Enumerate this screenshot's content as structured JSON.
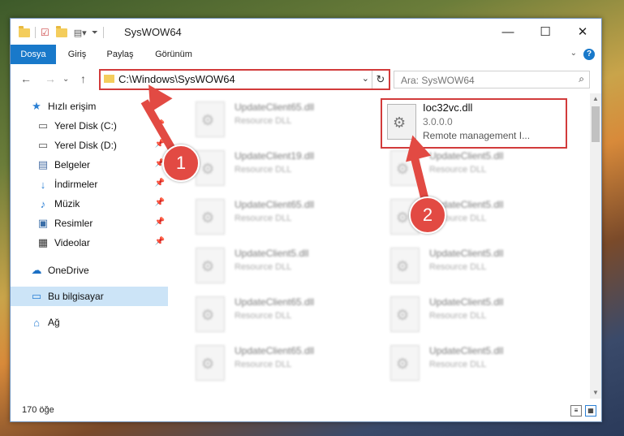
{
  "window": {
    "title": "SysWOW64",
    "controls": {
      "minimize": "—",
      "maximize": "☐",
      "close": "✕"
    }
  },
  "ribbon": {
    "tabs": [
      {
        "label": "Dosya",
        "active": true
      },
      {
        "label": "Giriş"
      },
      {
        "label": "Paylaş"
      },
      {
        "label": "Görünüm"
      }
    ],
    "help": "?"
  },
  "address": {
    "path": "C:\\Windows\\SysWOW64",
    "search_placeholder": "Ara: SysWOW64"
  },
  "nav_pane": {
    "items": [
      {
        "label": "Hızlı erişim",
        "icon": "star-icon",
        "pinned": false
      },
      {
        "label": "Yerel Disk (C:)",
        "icon": "drive-icon",
        "pinned": true
      },
      {
        "label": "Yerel Disk (D:)",
        "icon": "drive-icon",
        "pinned": true
      },
      {
        "label": "Belgeler",
        "icon": "document-icon",
        "pinned": true
      },
      {
        "label": "İndirmeler",
        "icon": "download-icon",
        "pinned": true
      },
      {
        "label": "Müzik",
        "icon": "music-icon",
        "pinned": true
      },
      {
        "label": "Resimler",
        "icon": "pictures-icon",
        "pinned": true
      },
      {
        "label": "Videolar",
        "icon": "video-icon",
        "pinned": true
      },
      {
        "label": "OneDrive",
        "icon": "cloud-icon",
        "pinned": false
      },
      {
        "label": "Bu bilgisayar",
        "icon": "computer-icon",
        "pinned": false,
        "selected": true
      },
      {
        "label": "Ağ",
        "icon": "network-icon",
        "pinned": false
      }
    ]
  },
  "files": {
    "left_column": [
      {
        "name": "UpdateClient65.dll",
        "type": "Resource DLL"
      },
      {
        "name": "UpdateClient19.dll",
        "type": "Resource DLL"
      },
      {
        "name": "UpdateClient65.dll",
        "type": "Resource DLL"
      },
      {
        "name": "UpdateClient5.dll",
        "type": "Resource DLL"
      },
      {
        "name": "UpdateClient65.dll",
        "type": "Resource DLL"
      },
      {
        "name": "UpdateClient65.dll",
        "type": "Resource DLL"
      }
    ],
    "right_column": [
      {
        "name": "UpdateClient5.dll",
        "type": "Resource DLL"
      },
      {
        "name": "UpdateClient5.dll",
        "type": "Resource DLL"
      },
      {
        "name": "UpdateClient5.dll",
        "type": "Resource DLL"
      },
      {
        "name": "UpdateClient5.dll",
        "type": "Resource DLL"
      },
      {
        "name": "UpdateClient5.dll",
        "type": "Resource DLL"
      }
    ],
    "highlighted": {
      "name": "Ioc32vc.dll",
      "version": "3.0.0.0",
      "description": "Remote management I..."
    }
  },
  "status_bar": {
    "item_count": "170 öğe"
  },
  "annotations": {
    "badge_1": "1",
    "badge_2": "2"
  }
}
